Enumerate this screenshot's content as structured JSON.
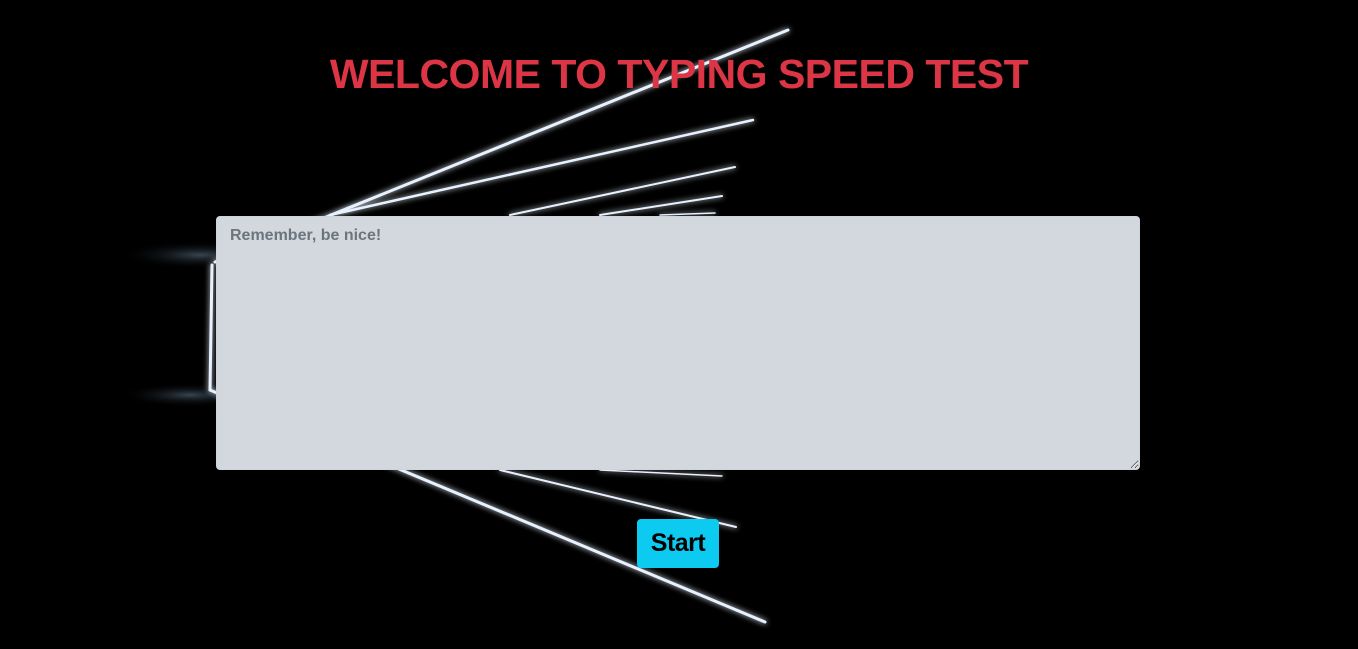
{
  "header": {
    "title": "WELCOME TO TYPING SPEED TEST"
  },
  "editor": {
    "placeholder": "Remember, be nice!",
    "value": ""
  },
  "controls": {
    "start_label": "Start"
  },
  "colors": {
    "background": "#000000",
    "title": "#dc3545",
    "textarea_bg": "#d3d8df",
    "start_button": "#0dcaf0"
  },
  "background_image": {
    "icon": "neon-light-tunnel-graphic"
  }
}
